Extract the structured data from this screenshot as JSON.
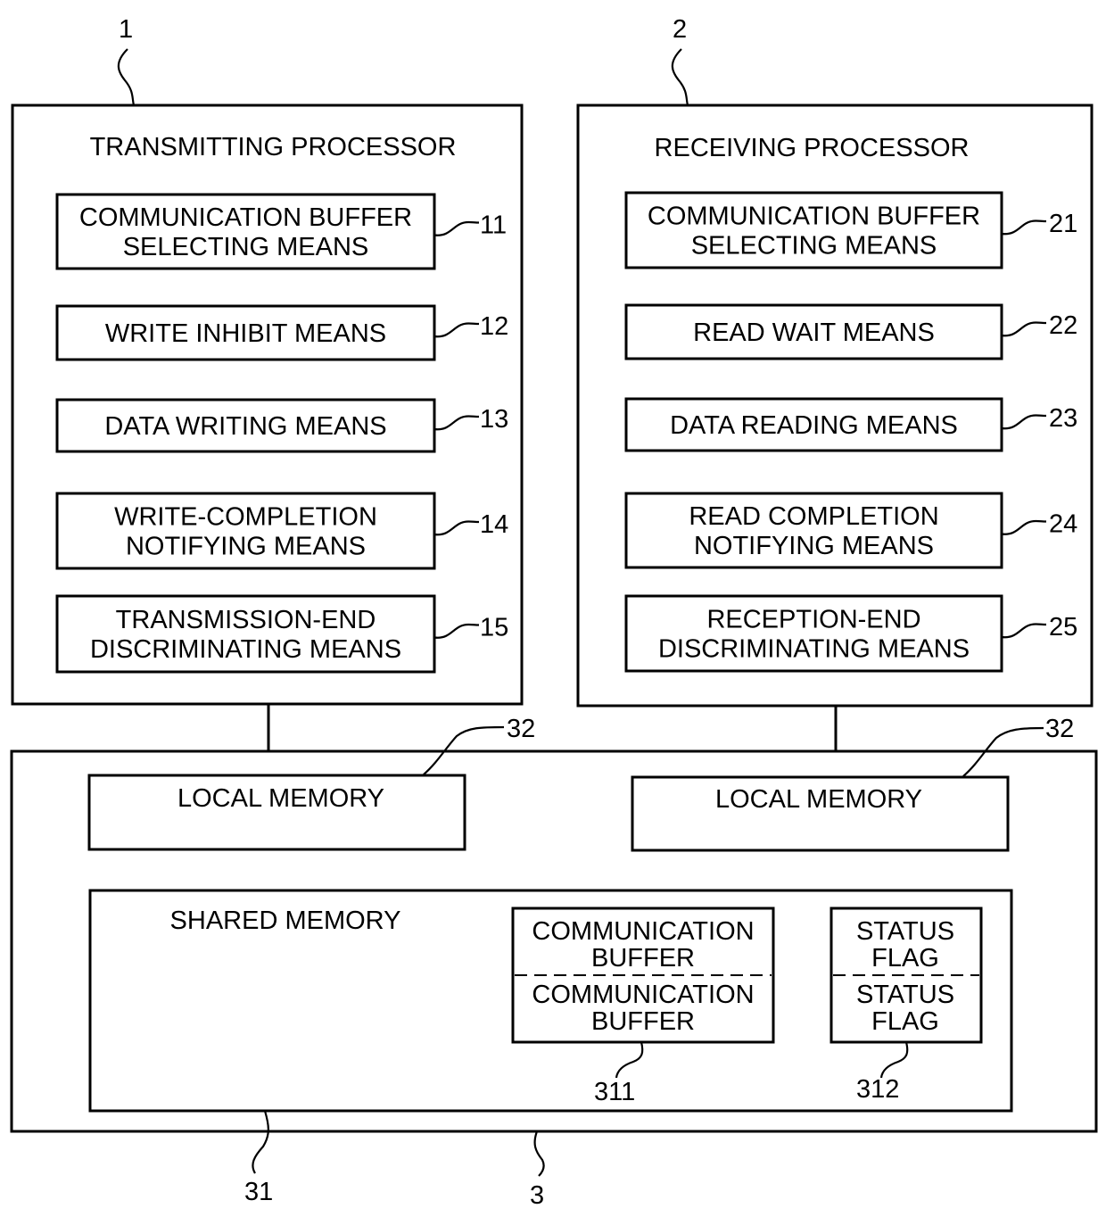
{
  "diagram": {
    "transmitting": {
      "ref": "1",
      "title": "TRANSMITTING PROCESSOR",
      "blocks": [
        {
          "lines": [
            "COMMUNICATION BUFFER",
            "SELECTING MEANS"
          ],
          "ref": "11"
        },
        {
          "lines": [
            "WRITE INHIBIT MEANS"
          ],
          "ref": "12"
        },
        {
          "lines": [
            "DATA WRITING MEANS"
          ],
          "ref": "13"
        },
        {
          "lines": [
            "WRITE-COMPLETION",
            "NOTIFYING MEANS"
          ],
          "ref": "14"
        },
        {
          "lines": [
            "TRANSMISSION-END",
            "DISCRIMINATING MEANS"
          ],
          "ref": "15"
        }
      ]
    },
    "receiving": {
      "ref": "2",
      "title": "RECEIVING PROCESSOR",
      "blocks": [
        {
          "lines": [
            "COMMUNICATION BUFFER",
            "SELECTING MEANS"
          ],
          "ref": "21"
        },
        {
          "lines": [
            "READ WAIT MEANS"
          ],
          "ref": "22"
        },
        {
          "lines": [
            "DATA READING MEANS"
          ],
          "ref": "23"
        },
        {
          "lines": [
            "READ COMPLETION",
            "NOTIFYING MEANS"
          ],
          "ref": "24"
        },
        {
          "lines": [
            "RECEPTION-END",
            "DISCRIMINATING MEANS"
          ],
          "ref": "25"
        }
      ]
    },
    "memory": {
      "ref": "3",
      "local_left": {
        "label": "LOCAL MEMORY",
        "ref": "32"
      },
      "local_right": {
        "label": "LOCAL MEMORY",
        "ref": "32"
      },
      "shared": {
        "label": "SHARED MEMORY",
        "ref": "31",
        "buffers": {
          "lines": [
            "COMMUNICATION",
            "BUFFER",
            "COMMUNICATION",
            "BUFFER"
          ],
          "ref": "311"
        },
        "flags": {
          "lines": [
            "STATUS",
            "FLAG",
            "STATUS",
            "FLAG"
          ],
          "ref": "312"
        }
      }
    }
  }
}
